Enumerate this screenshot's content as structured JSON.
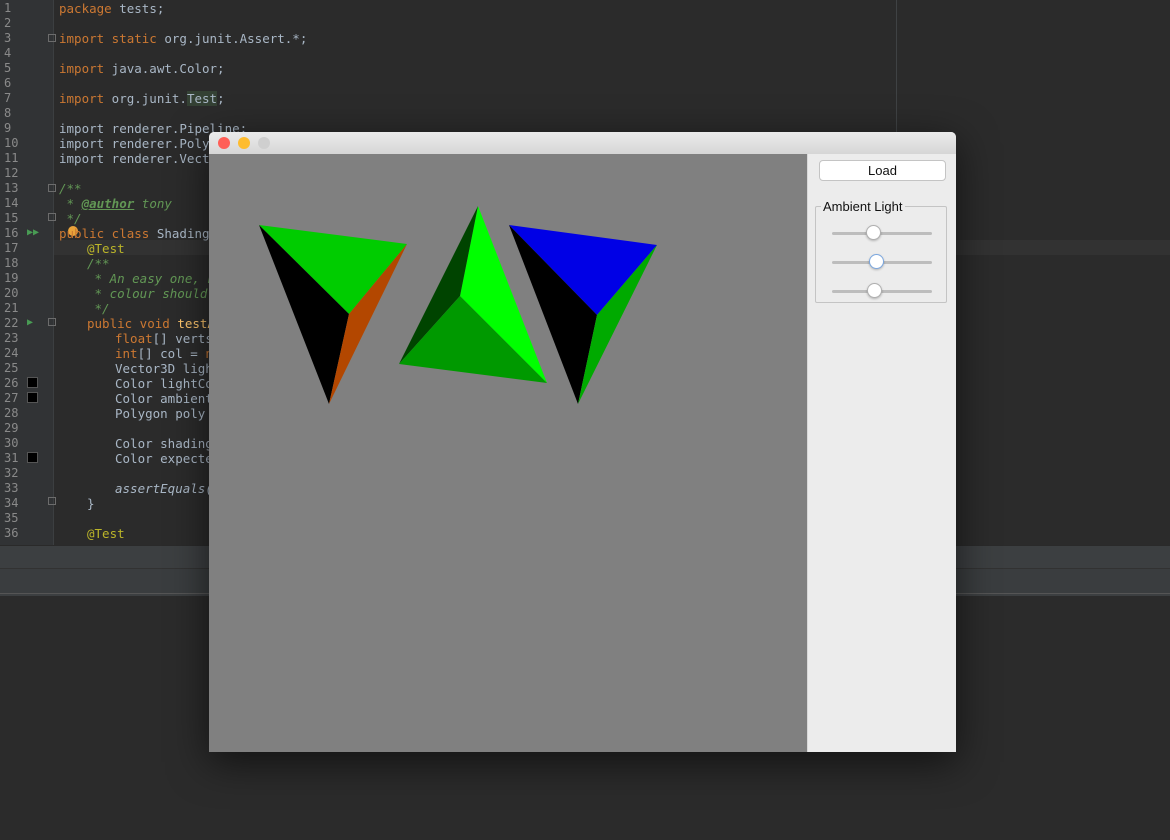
{
  "editor": {
    "line_numbers": [
      "1",
      "2",
      "3",
      "4",
      "5",
      "6",
      "7",
      "8",
      "9",
      "10",
      "11",
      "12",
      "13",
      "14",
      "15",
      "16",
      "17",
      "18",
      "19",
      "20",
      "21",
      "22",
      "23",
      "24",
      "25",
      "26",
      "27",
      "28",
      "29",
      "30",
      "31",
      "32",
      "33",
      "34",
      "35",
      "36"
    ],
    "lines": {
      "l1_kw": "package",
      "l1_txt": " tests;",
      "l3_kw": "import static",
      "l3_txt": " org.junit.Assert.*;",
      "l5_kw": "import",
      "l5_txt": " java.awt.Color;",
      "l7_kw": "import",
      "l7_txt": " org.junit.",
      "l7_hl": "Test",
      "l7_end": ";",
      "l9": "import renderer.Pipeline;",
      "l10": "import renderer.Polygo",
      "l11": "import renderer.Vecto",
      "l13": "/**",
      "l14_pre": " * ",
      "l14_tag": "@author",
      "l14_post": " tony",
      "l15": " */",
      "l16_kw": "public class",
      "l16_txt": " ShadingTe",
      "l17": "@Test",
      "l18": "/**",
      "l19": " * An easy one, h",
      "l20": " * colour should ",
      "l21": " */",
      "l22_kw": "public void",
      "l22_txt": " testA",
      "l23_kw": "float",
      "l23_txt": "[] verts",
      "l24_kw": "int",
      "l24_txt": "[] col = ",
      "l24_new": "ne",
      "l25": "Vector3D ligh",
      "l26": "Color lightCo",
      "l27": "Color ambient",
      "l28": "Polygon poly =",
      "l30": "Color shading",
      "l31": "Color expecte",
      "l33": "assertEquals(",
      "l34": "}",
      "l36": "@Test"
    }
  },
  "app_window": {
    "load_button": "Load",
    "ambient_group_title": "Ambient Light",
    "sliders": [
      {
        "name": "ambient-red",
        "value": 0.42
      },
      {
        "name": "ambient-green",
        "value": 0.45
      },
      {
        "name": "ambient-blue",
        "value": 0.43
      }
    ]
  },
  "scene": {
    "background": "#808080",
    "pyramids": [
      {
        "name": "pyramid-left",
        "faces": [
          "#00cc00",
          "#000000",
          "#b34700"
        ]
      },
      {
        "name": "pyramid-middle",
        "faces": [
          "#00ff00",
          "#004400",
          "#009900"
        ]
      },
      {
        "name": "pyramid-right",
        "faces": [
          "#0000e6",
          "#000000",
          "#00aa00"
        ]
      }
    ]
  },
  "colors": {
    "close": "#ff5f57",
    "minimize": "#febc2e",
    "zoom": "#cfcfcf"
  }
}
